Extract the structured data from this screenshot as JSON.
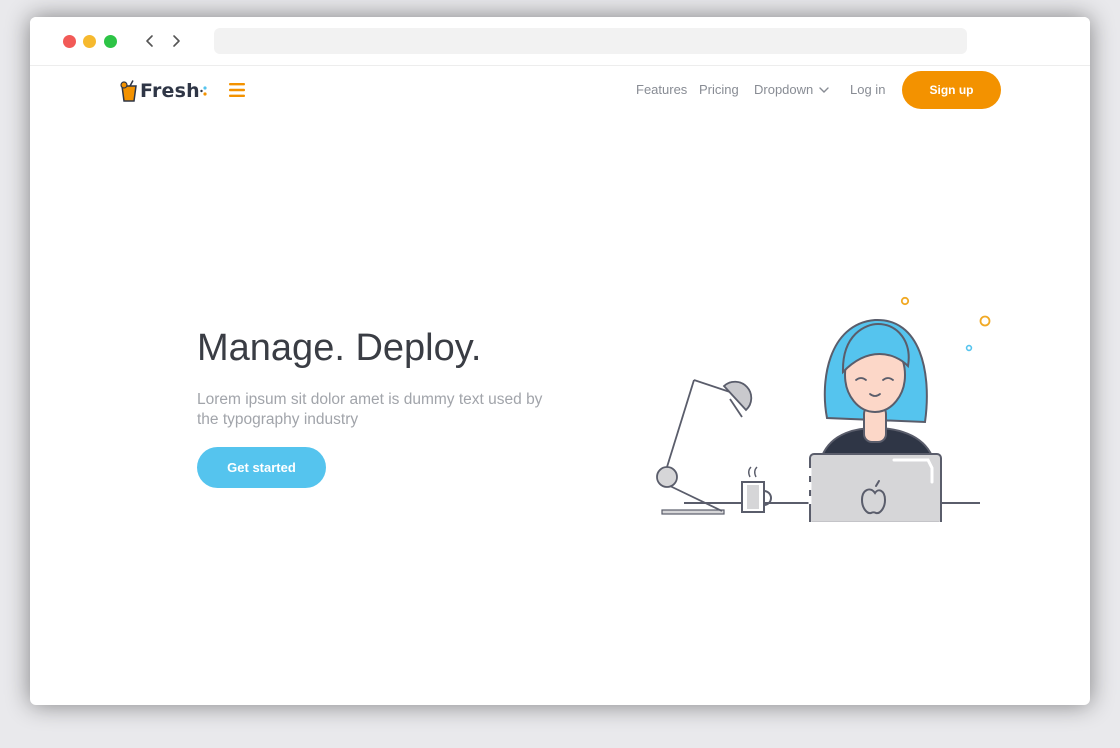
{
  "browser": {
    "window_controls": [
      "close",
      "minimize",
      "maximize"
    ],
    "nav_icons": [
      "back-arrow-icon",
      "forward-arrow-icon"
    ],
    "address": ""
  },
  "site": {
    "logo_text": "Fresh",
    "menu_icon": "hamburger-icon",
    "nav": {
      "features": "Features",
      "pricing": "Pricing",
      "dropdown": "Dropdown",
      "login": "Log in",
      "signup": "Sign up"
    },
    "colors": {
      "accent_orange": "#f39200",
      "accent_blue": "#55c4ee",
      "heading": "#3a3d44",
      "muted_text": "#a1a4aa"
    }
  },
  "hero": {
    "title": "Manage. Deploy.",
    "subtitle": "Lorem ipsum sit dolor amet is dummy text used by the typography industry",
    "cta": "Get started",
    "illustration": "woman-at-laptop-illustration"
  }
}
